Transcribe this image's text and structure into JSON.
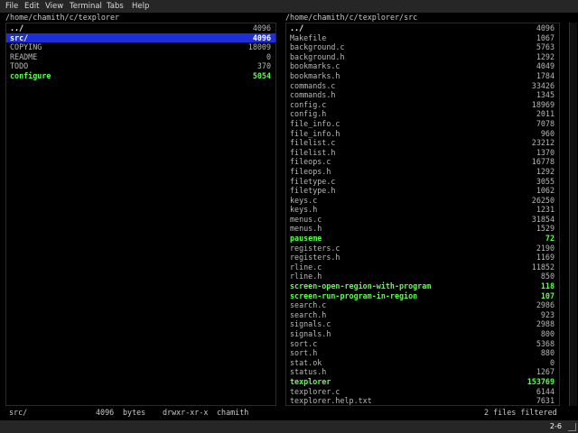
{
  "menubar": {
    "items": [
      "File",
      "Edit",
      "View",
      "Terminal",
      "Tabs",
      "Help"
    ]
  },
  "left_panel": {
    "path": "/home/chamith/c/texplorer",
    "entries": [
      {
        "name": "../",
        "size": "4096",
        "kind": "parent"
      },
      {
        "name": "src/",
        "size": "4096",
        "kind": "selected"
      },
      {
        "name": "COPYING",
        "size": "18009",
        "kind": "file"
      },
      {
        "name": "README",
        "size": "0",
        "kind": "file"
      },
      {
        "name": "TODO",
        "size": "370",
        "kind": "file"
      },
      {
        "name": "configure",
        "size": "5054",
        "kind": "exec"
      }
    ]
  },
  "right_panel": {
    "path": "/home/chamith/c/texplorer/src",
    "entries": [
      {
        "name": "../",
        "size": "4096",
        "kind": "parent"
      },
      {
        "name": "Makefile",
        "size": "1067",
        "kind": "file"
      },
      {
        "name": "background.c",
        "size": "5763",
        "kind": "file"
      },
      {
        "name": "background.h",
        "size": "1292",
        "kind": "file"
      },
      {
        "name": "bookmarks.c",
        "size": "4049",
        "kind": "file"
      },
      {
        "name": "bookmarks.h",
        "size": "1784",
        "kind": "file"
      },
      {
        "name": "commands.c",
        "size": "33426",
        "kind": "file"
      },
      {
        "name": "commands.h",
        "size": "1345",
        "kind": "file"
      },
      {
        "name": "config.c",
        "size": "18969",
        "kind": "file"
      },
      {
        "name": "config.h",
        "size": "2011",
        "kind": "file"
      },
      {
        "name": "file_info.c",
        "size": "7078",
        "kind": "file"
      },
      {
        "name": "file_info.h",
        "size": "960",
        "kind": "file"
      },
      {
        "name": "filelist.c",
        "size": "23212",
        "kind": "file"
      },
      {
        "name": "filelist.h",
        "size": "1370",
        "kind": "file"
      },
      {
        "name": "fileops.c",
        "size": "16778",
        "kind": "file"
      },
      {
        "name": "fileops.h",
        "size": "1292",
        "kind": "file"
      },
      {
        "name": "filetype.c",
        "size": "3055",
        "kind": "file"
      },
      {
        "name": "filetype.h",
        "size": "1062",
        "kind": "file"
      },
      {
        "name": "keys.c",
        "size": "26250",
        "kind": "file"
      },
      {
        "name": "keys.h",
        "size": "1231",
        "kind": "file"
      },
      {
        "name": "menus.c",
        "size": "31854",
        "kind": "file"
      },
      {
        "name": "menus.h",
        "size": "1529",
        "kind": "file"
      },
      {
        "name": "pauseme",
        "size": "72",
        "kind": "exec"
      },
      {
        "name": "registers.c",
        "size": "2190",
        "kind": "file"
      },
      {
        "name": "registers.h",
        "size": "1169",
        "kind": "file"
      },
      {
        "name": "rline.c",
        "size": "11852",
        "kind": "file"
      },
      {
        "name": "rline.h",
        "size": "850",
        "kind": "file"
      },
      {
        "name": "screen-open-region-with-program",
        "size": "118",
        "kind": "exec"
      },
      {
        "name": "screen-run-program-in-region",
        "size": "107",
        "kind": "exec"
      },
      {
        "name": "search.c",
        "size": "2986",
        "kind": "file"
      },
      {
        "name": "search.h",
        "size": "923",
        "kind": "file"
      },
      {
        "name": "signals.c",
        "size": "2988",
        "kind": "file"
      },
      {
        "name": "signals.h",
        "size": "800",
        "kind": "file"
      },
      {
        "name": "sort.c",
        "size": "5368",
        "kind": "file"
      },
      {
        "name": "sort.h",
        "size": "880",
        "kind": "file"
      },
      {
        "name": "stat.ok",
        "size": "0",
        "kind": "file"
      },
      {
        "name": "status.h",
        "size": "1267",
        "kind": "file"
      },
      {
        "name": "texplorer",
        "size": "153769",
        "kind": "exec"
      },
      {
        "name": "texplorer.c",
        "size": "6144",
        "kind": "file"
      },
      {
        "name": "texplorer.help.txt",
        "size": "7631",
        "kind": "file"
      }
    ]
  },
  "statusbar": {
    "name": "src/",
    "size": "4096",
    "unit": "bytes",
    "perms": "drwxr-xr-x",
    "owner": "chamith",
    "filter_info": "2 files filtered"
  },
  "bottombar": {
    "page": "2-6"
  }
}
